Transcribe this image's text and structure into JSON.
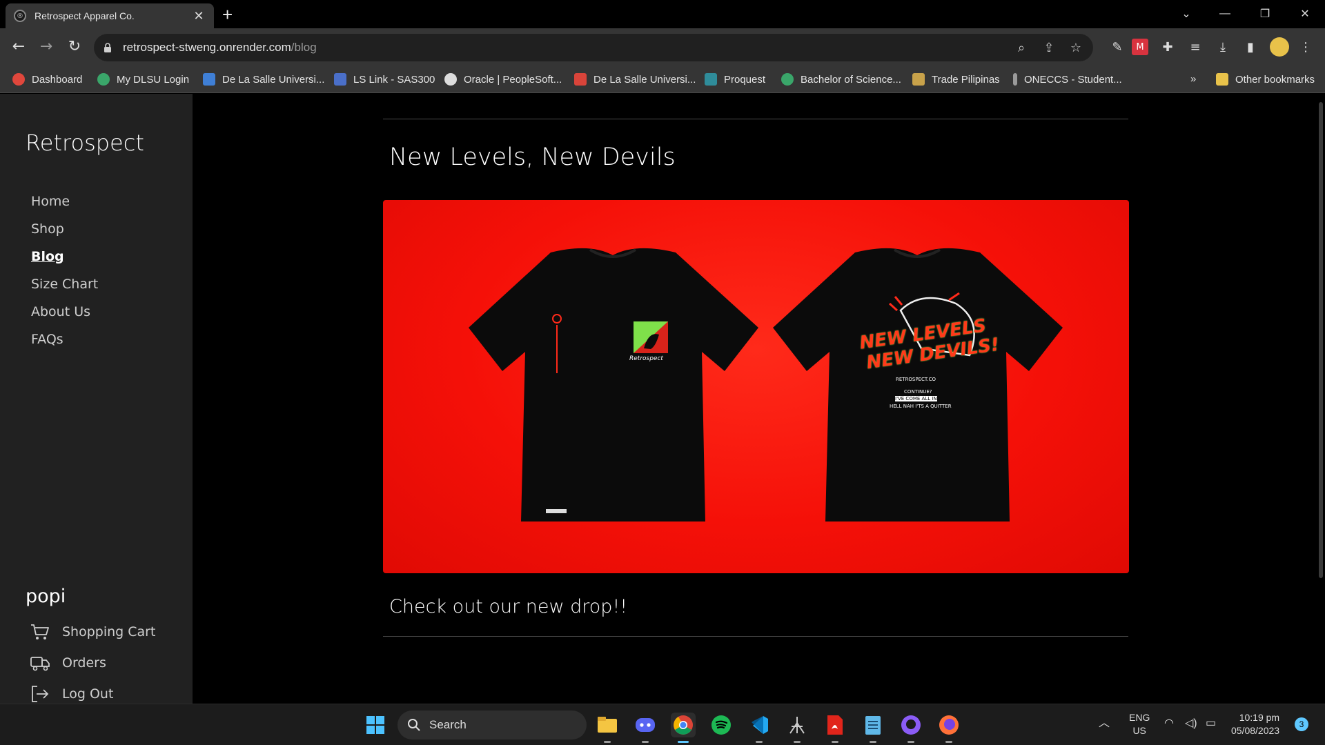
{
  "browser": {
    "tab_title": "Retrospect Apparel Co.",
    "url_host": "retrospect-stweng.onrender.com",
    "url_path": "/blog",
    "bookmarks": [
      {
        "label": "Dashboard",
        "color": "#e0473c"
      },
      {
        "label": "My DLSU Login",
        "color": "#3aa66a"
      },
      {
        "label": "De La Salle Universi...",
        "color": "#3f7fd6"
      },
      {
        "label": "LS Link - SAS300",
        "color": "#4a6fc9"
      },
      {
        "label": "Oracle | PeopleSoft...",
        "color": "#dddddd"
      },
      {
        "label": "De La Salle Universi...",
        "color": "#d9443a"
      },
      {
        "label": "Proquest",
        "color": "#2f8c9a"
      },
      {
        "label": "Bachelor of Science...",
        "color": "#3aa66a"
      },
      {
        "label": "Trade Pilipinas",
        "color": "#c8a24a"
      },
      {
        "label": "ONECCS - Student...",
        "color": "#9a9a9a"
      }
    ],
    "overflow_label": "»",
    "other_bookmarks": "Other bookmarks"
  },
  "sidebar": {
    "brand": "Retrospect",
    "nav": [
      {
        "label": "Home"
      },
      {
        "label": "Shop"
      },
      {
        "label": "Blog",
        "active": true
      },
      {
        "label": "Size Chart"
      },
      {
        "label": "About Us"
      },
      {
        "label": "FAQs"
      }
    ],
    "username": "popi",
    "user_links": [
      {
        "label": "Shopping Cart",
        "icon": "cart-icon"
      },
      {
        "label": "Orders",
        "icon": "truck-icon"
      },
      {
        "label": "Log Out",
        "icon": "logout-icon"
      }
    ]
  },
  "post": {
    "title": "New Levels, New Devils",
    "caption": "Check out our new drop!!",
    "image": {
      "front_brand": "Retrospect",
      "back_headline_1": "NEW LEVELS",
      "back_headline_2": "NEW DEVILS!",
      "back_line_1": "CONTINUE?",
      "back_line_2": "I'VE COME ALL IN",
      "back_line_3": "HELL NAH I'TS A QUITTER",
      "back_brand": "RETROSPECT.CO"
    }
  },
  "taskbar": {
    "search_label": "Search",
    "apps": [
      "start-icon",
      "file-explorer-icon",
      "discord-icon",
      "chrome-icon",
      "spotify-icon",
      "vscode-icon",
      "network-app-icon",
      "acrobat-icon",
      "notepad-icon",
      "github-icon",
      "firefox-icon"
    ],
    "lang_1": "ENG",
    "lang_2": "US",
    "time": "10:19 pm",
    "date": "05/08/2023",
    "notifications": "3"
  }
}
